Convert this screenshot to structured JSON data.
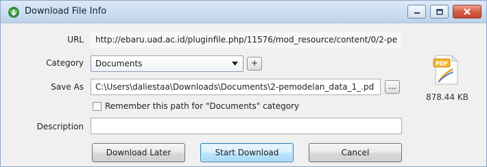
{
  "window": {
    "title": "Download File Info"
  },
  "form": {
    "url_label": "URL",
    "url_value": "http://ebaru.uad.ac.id/pluginfile.php/11576/mod_resource/content/0/2-pe",
    "category_label": "Category",
    "category_value": "Documents",
    "add_category_label": "+",
    "save_as_label": "Save As",
    "save_as_value": "C:\\Users\\daliestaa\\Downloads\\Documents\\2-pemodelan_data_1_.pd",
    "browse_label": "...",
    "remember_label": "Remember this path for \"Documents\" category",
    "remember_checked": false,
    "description_label": "Description",
    "description_value": ""
  },
  "file": {
    "icon": "pdf-file-icon",
    "size": "878.44 KB"
  },
  "buttons": {
    "download_later": "Download Later",
    "start_download": "Start Download",
    "cancel": "Cancel"
  }
}
